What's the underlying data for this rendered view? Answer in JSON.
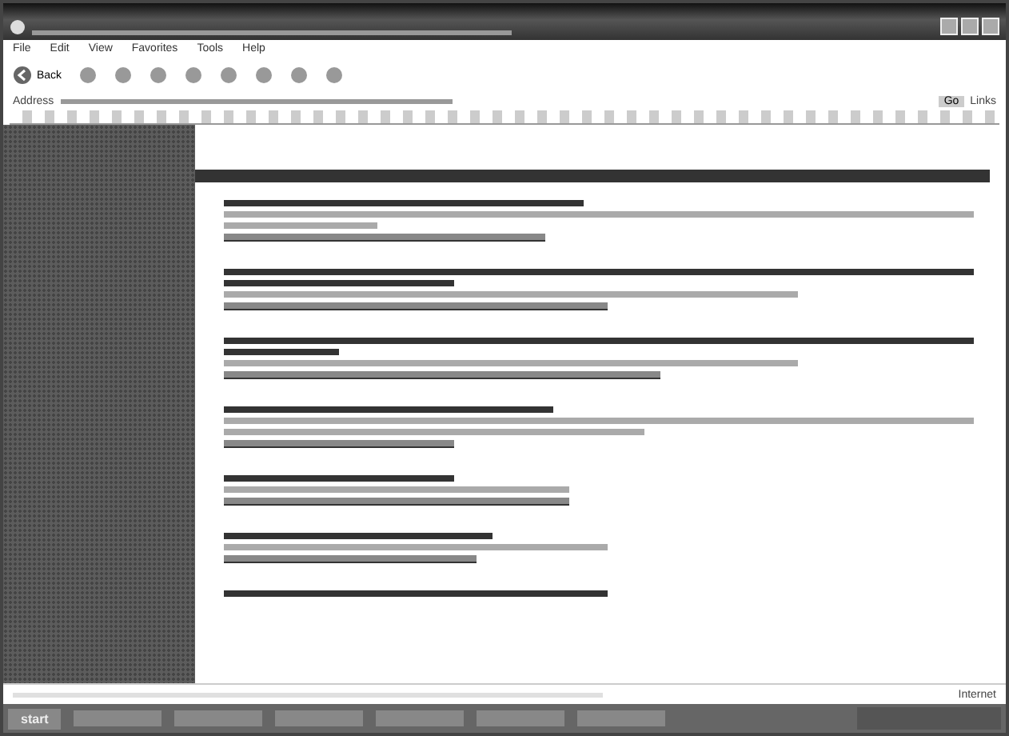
{
  "menu": [
    "File",
    "Edit",
    "View",
    "Favorites",
    "Tools",
    "Help"
  ],
  "toolbar": {
    "back": "Back"
  },
  "address": {
    "label": "Address",
    "go": "Go",
    "links": "Links"
  },
  "entries": [
    {
      "lines": [
        {
          "kind": "bold"
        },
        {
          "kind": "plain"
        },
        {
          "kind": "plain"
        },
        {
          "kind": "link"
        }
      ]
    },
    {
      "lines": [
        {
          "kind": "bold"
        },
        {
          "kind": "bold"
        },
        {
          "kind": "plain"
        },
        {
          "kind": "link"
        }
      ]
    },
    {
      "lines": [
        {
          "kind": "bold"
        },
        {
          "kind": "bold"
        },
        {
          "kind": "plain"
        },
        {
          "kind": "link"
        }
      ]
    },
    {
      "lines": [
        {
          "kind": "bold"
        },
        {
          "kind": "plain"
        },
        {
          "kind": "plain"
        },
        {
          "kind": "link"
        }
      ]
    },
    {
      "lines": [
        {
          "kind": "bold"
        },
        {
          "kind": "plain"
        },
        {
          "kind": "link"
        }
      ]
    },
    {
      "lines": [
        {
          "kind": "bold"
        },
        {
          "kind": "plain"
        },
        {
          "kind": "link"
        }
      ]
    },
    {
      "lines": [
        {
          "kind": "bold"
        }
      ]
    }
  ],
  "status": {
    "zone": "Internet"
  },
  "taskbar": {
    "start": "start"
  }
}
